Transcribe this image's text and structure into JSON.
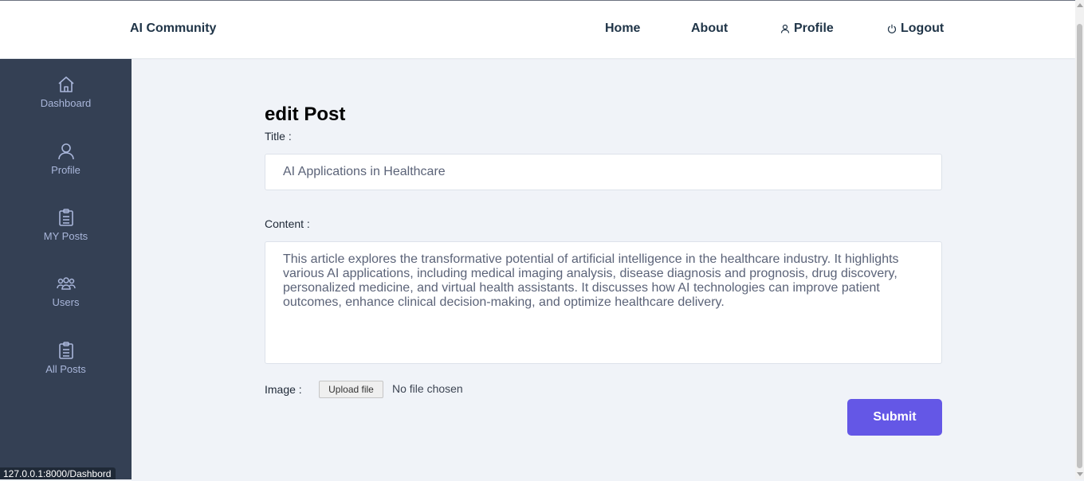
{
  "header": {
    "brand": "AI Community",
    "nav": {
      "home": "Home",
      "about": "About",
      "profile": "Profile",
      "logout": "Logout"
    }
  },
  "sidebar": {
    "items": [
      {
        "label": "Dashboard",
        "icon": "home-icon"
      },
      {
        "label": "Profile",
        "icon": "user-icon"
      },
      {
        "label": "MY Posts",
        "icon": "clipboard-icon"
      },
      {
        "label": "Users",
        "icon": "users-icon"
      },
      {
        "label": "All Posts",
        "icon": "clipboard-icon"
      }
    ]
  },
  "form": {
    "heading": "edit Post",
    "title_label": "Title :",
    "title_value": "AI Applications in Healthcare",
    "content_label": "Content :",
    "content_value": "This article explores the transformative potential of artificial intelligence in the healthcare industry. It highlights various AI applications, including medical imaging analysis, disease diagnosis and prognosis, drug discovery, personalized medicine, and virtual health assistants. It discusses how AI technologies can improve patient outcomes, enhance clinical decision-making, and optimize healthcare delivery.",
    "image_label": "Image :",
    "upload_label": "Upload file",
    "no_file_text": "No file chosen",
    "submit_label": "Submit"
  },
  "status_bar": {
    "url": "127.0.0.1:8000/Dashbord"
  },
  "colors": {
    "sidebar_bg": "#344054",
    "accent": "#6457e6",
    "page_bg": "#f0f3f8"
  }
}
